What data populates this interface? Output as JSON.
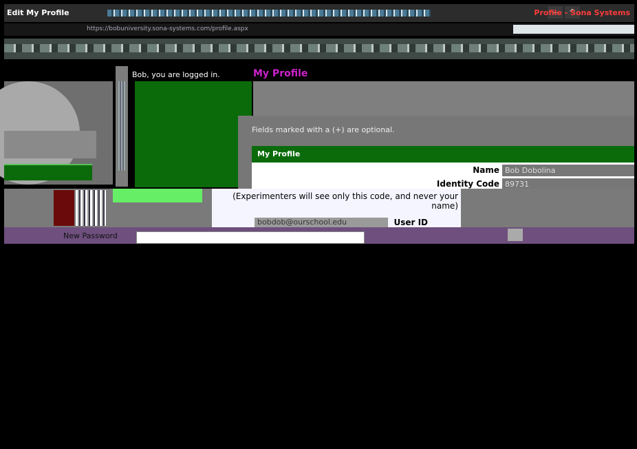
{
  "browser": {
    "tab_title": "Edit My Profile",
    "right_title": "Profile - Sona Systems",
    "url": "https://bobuniversity.sona-systems.com/profile.aspx",
    "controls": {
      "minimize": "–",
      "maximize": "^",
      "close": "×"
    }
  },
  "page": {
    "logged_in_text": "Bob, you are logged in.",
    "title": "My Profile",
    "optional_note": "Fields marked with a (+) are optional.",
    "table_title": "My Profile",
    "rows": [
      {
        "label": "Name",
        "value": "Bob Dobolina"
      },
      {
        "label": "Identity Code",
        "value": "89731"
      }
    ],
    "identity_help": "(Experimenters will see only this code, and never your name)",
    "user_id_label": "User ID",
    "user_id_value": "bobdob@ourschool.edu",
    "new_password_label": "New Password"
  },
  "colors": {
    "accent_green": "#0b6b0b",
    "title_magenta": "#cc22cc",
    "band_purple": "#6e4f7e"
  }
}
